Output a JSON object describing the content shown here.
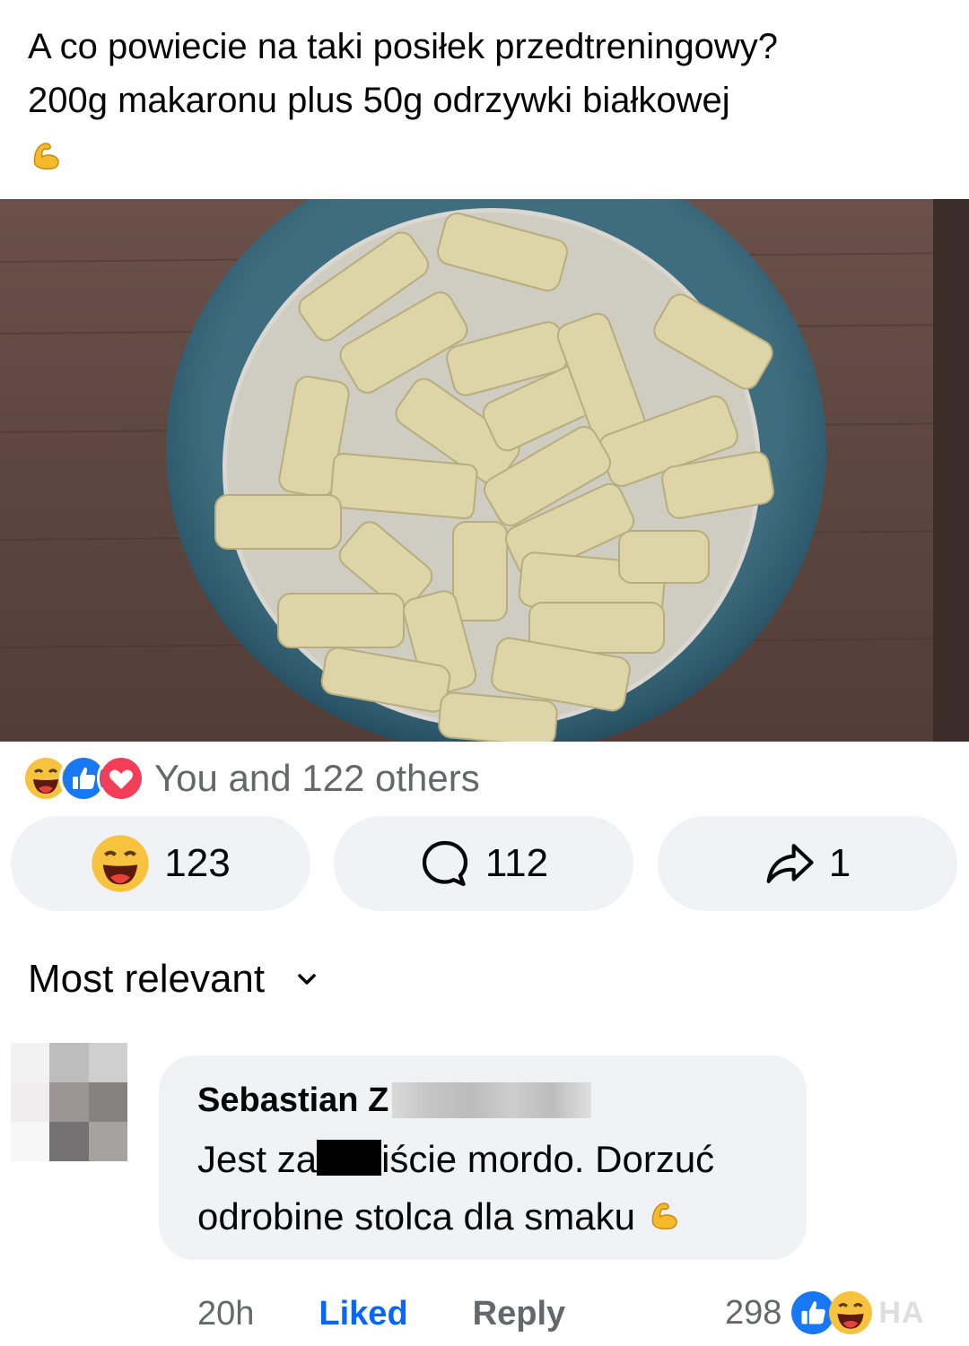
{
  "post": {
    "text_line1": "A co powiecie na taki posiłek przedtreningowy?",
    "text_line2": "200g makaronu plus 50g odrzywki białkowej",
    "emoji_icon": "flexed-biceps-icon"
  },
  "reactions": {
    "icons": [
      "laughing-emoji-icon",
      "like-icon",
      "love-icon"
    ],
    "summary": "You and 122 others"
  },
  "actions": {
    "react_count": "123",
    "comment_count": "112",
    "share_count": "1"
  },
  "sort": {
    "label": "Most relevant",
    "icon": "chevron-down-icon"
  },
  "comment": {
    "author_visible": "Sebastian Z",
    "text_part1": "Jest za",
    "text_part2": "iście mordo. Dorzuć",
    "text_line2": "odrobine stolca dla smaku",
    "time": "20h",
    "liked_label": "Liked",
    "reply_label": "Reply",
    "reaction_count": "298",
    "watermark": "HA"
  },
  "colors": {
    "accent_blue": "#0866ff",
    "pill_bg": "#f0f2f5",
    "secondary_text": "#65676b"
  }
}
